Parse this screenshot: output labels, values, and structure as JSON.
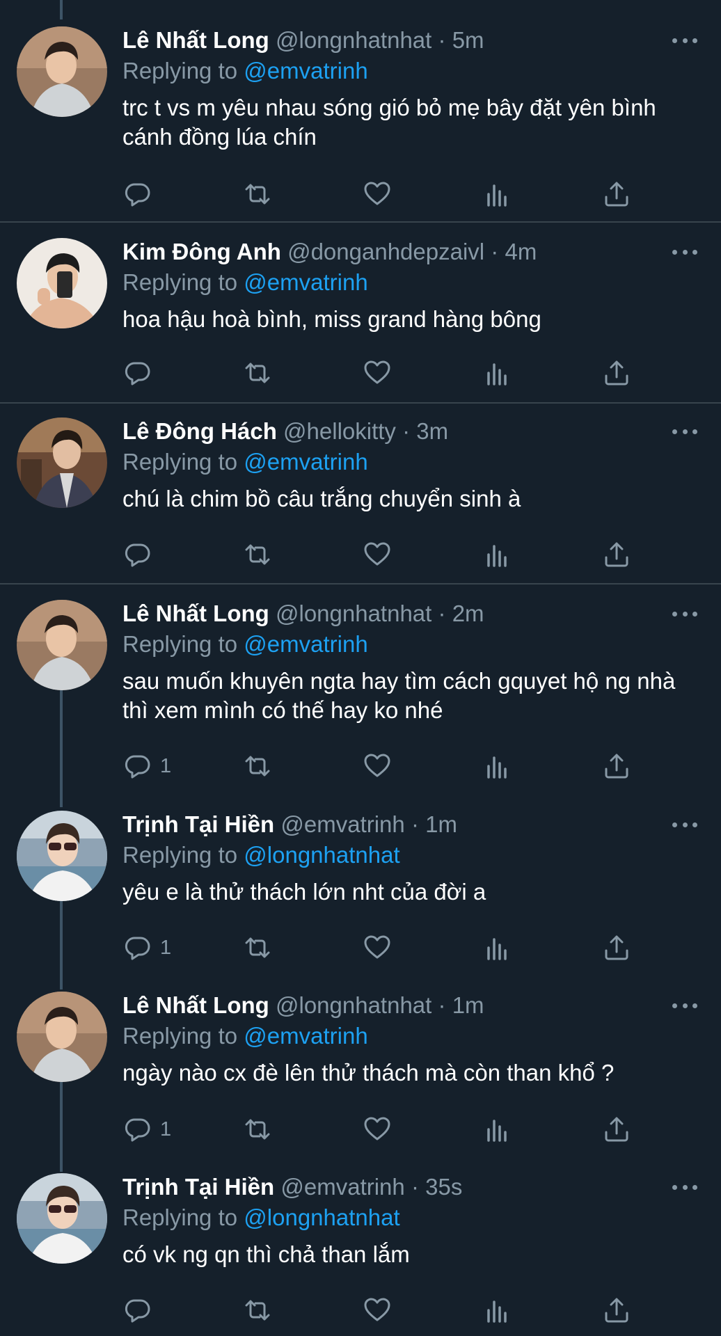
{
  "tweets": [
    {
      "name": "Lê Nhất Long",
      "handle": "@longnhatnhat",
      "time": "5m",
      "replying_to_prefix": "Replying to",
      "replying_to": "@emvatrinh",
      "text": "trc t vs m yêu nhau sóng gió bỏ mẹ bây đặt yên bình cánh đồng lúa chín",
      "reply_count": "",
      "avatar": "long-avatar"
    },
    {
      "name": "Kim Đông Anh",
      "handle": "@donganhdepzaivl",
      "time": "4m",
      "replying_to_prefix": "Replying to",
      "replying_to": "@emvatrinh",
      "text": "hoa hậu hoà bình, miss grand hàng bông",
      "reply_count": "",
      "avatar": "donganh-avatar"
    },
    {
      "name": "Lê Đông Hách",
      "handle": "@hellokitty",
      "time": "3m",
      "replying_to_prefix": "Replying to",
      "replying_to": "@emvatrinh",
      "text": "chú là chim bồ câu trắng chuyển sinh à",
      "reply_count": "",
      "avatar": "donghach-avatar"
    },
    {
      "name": "Lê Nhất Long",
      "handle": "@longnhatnhat",
      "time": "2m",
      "replying_to_prefix": "Replying to",
      "replying_to": "@emvatrinh",
      "text": "sau muốn khuyên ngta hay tìm cách gquyet hộ ng nhà thì xem mình có thế hay ko nhé",
      "reply_count": "1",
      "avatar": "long-avatar"
    },
    {
      "name": "Trịnh Tại Hiền",
      "handle": "@emvatrinh",
      "time": "1m",
      "replying_to_prefix": "Replying to",
      "replying_to": "@longnhatnhat",
      "text": "yêu e là thử thách lớn nht của đời a",
      "reply_count": "1",
      "avatar": "hien-avatar"
    },
    {
      "name": "Lê Nhất Long",
      "handle": "@longnhatnhat",
      "time": "1m",
      "replying_to_prefix": "Replying to",
      "replying_to": "@emvatrinh",
      "text": "ngày nào cx đè lên thử thách mà còn than khổ ?",
      "reply_count": "1",
      "avatar": "long-avatar"
    },
    {
      "name": "Trịnh Tại Hiền",
      "handle": "@emvatrinh",
      "time": "35s",
      "replying_to_prefix": "Replying to",
      "replying_to": "@longnhatnhat",
      "text": "có vk ng qn thì chả than lắm",
      "reply_count": "",
      "avatar": "hien-avatar"
    }
  ],
  "meta_separator": "·",
  "icons": {
    "reply": "reply-icon",
    "retweet": "retweet-icon",
    "like": "heart-icon",
    "analytics": "analytics-icon",
    "share": "share-icon",
    "more": "more-icon"
  },
  "colors": {
    "background": "#15202b",
    "link": "#1da1f2",
    "muted": "#8899a6",
    "divider": "#38444d"
  }
}
